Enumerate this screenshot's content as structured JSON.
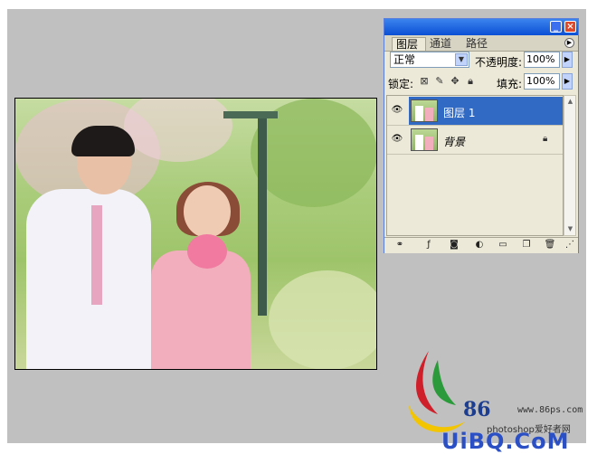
{
  "panel": {
    "tabs": [
      "图层",
      "通道",
      "路径"
    ],
    "blend_mode": "正常",
    "opacity_label": "不透明度:",
    "opacity_value": "100%",
    "lock_label": "锁定:",
    "fill_label": "填充:",
    "fill_value": "100%",
    "layers": [
      {
        "name": "图层 1",
        "selected": true,
        "visible": true
      },
      {
        "name": "背景",
        "selected": false,
        "visible": true,
        "locked": true
      }
    ]
  },
  "watermark": {
    "logo_text": "86",
    "url": "www.86ps.com",
    "subtitle": "photoshop爱好者网",
    "brand": "UiBQ.CoM"
  },
  "colors": {
    "workspace": "#c0c0c0",
    "selection": "#316ac5",
    "title_bar": "#0a4fd5",
    "panel_bg": "#ece9d8"
  }
}
